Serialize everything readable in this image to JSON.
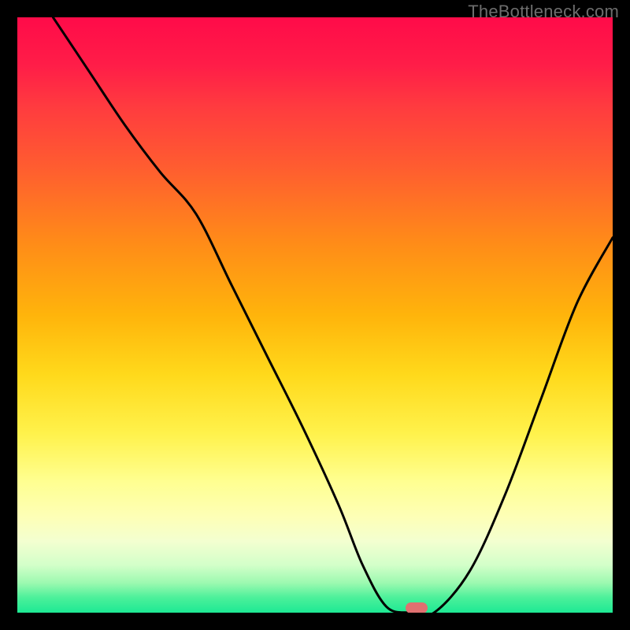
{
  "watermark": "TheBottleneck.com",
  "colors": {
    "frame_bg": "#000000",
    "curve_stroke": "#000000",
    "marker_fill": "#e07070",
    "watermark": "#6d6d6d"
  },
  "chart_data": {
    "type": "line",
    "title": "",
    "xlabel": "",
    "ylabel": "",
    "xlim": [
      0,
      100
    ],
    "ylim": [
      0,
      100
    ],
    "grid": false,
    "series": [
      {
        "name": "bottleneck-curve",
        "x": [
          6,
          12,
          18,
          24,
          30,
          36,
          42,
          48,
          54,
          58,
          62,
          66,
          70,
          76,
          82,
          88,
          94,
          100
        ],
        "y": [
          100,
          91,
          82,
          74,
          67,
          55,
          43,
          31,
          18,
          8,
          1,
          0,
          0,
          7,
          20,
          36,
          52,
          63
        ]
      }
    ],
    "marker": {
      "x": 67,
      "y": 0.8
    }
  }
}
